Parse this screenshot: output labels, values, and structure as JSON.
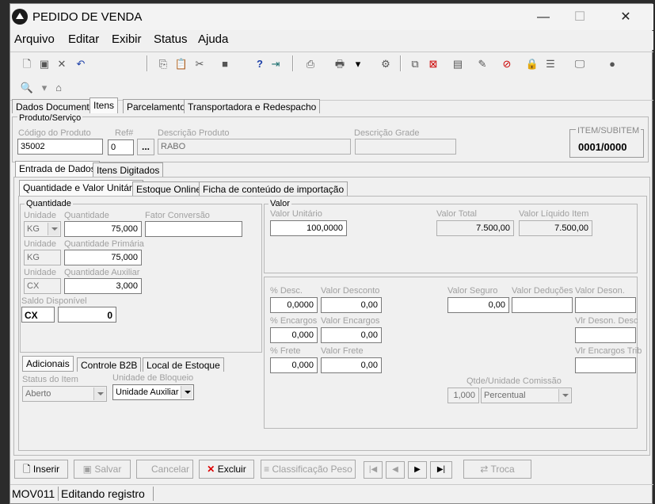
{
  "window": {
    "title": "PEDIDO DE VENDA"
  },
  "titlebar_buttons": {
    "minimize": "—",
    "maximize": "☐",
    "close": "✕"
  },
  "menu": [
    "Arquivo",
    "Editar",
    "Exibir",
    "Status",
    "Ajuda"
  ],
  "main_tabs": [
    "Dados Documento",
    "Itens",
    "Parcelamento",
    "Transportadora e Redespacho"
  ],
  "produto": {
    "group_label": "Produto/Serviço",
    "codigo_label": "Código do Produto",
    "codigo_value": "35002",
    "ref_label": "Ref#",
    "ref_value": "0",
    "lookup_button": "...",
    "descricao_label": "Descrição Produto",
    "descricao_value": "RABO",
    "grade_label": "Descrição Grade",
    "grade_value": "",
    "item_label": "ITEM/SUBITEM",
    "item_value": "0001/0000"
  },
  "sub_tabs": [
    "Entrada de Dados",
    "Itens Digitados"
  ],
  "inner_tabs": [
    "Quantidade e Valor Unitário",
    "Estoque Online",
    "Ficha de conteúdo de importação"
  ],
  "quantidade": {
    "group_label": "Quantidade",
    "unidade_label": "Unidade",
    "unidade_value": "KG",
    "quantidade_label": "Quantidade",
    "quantidade_value": "75,000",
    "fator_label": "Fator Conversão",
    "fator_value": "",
    "unidade2_label": "Unidade",
    "unidade2_value": "KG",
    "primaria_label": "Quantidade Primária",
    "primaria_value": "75,000",
    "unidade3_label": "Unidade",
    "unidade3_value": "CX",
    "auxiliar_label": "Quantidade Auxiliar",
    "auxiliar_value": "3,000",
    "saldo_label": "Saldo Disponível",
    "saldo_unit": "CX",
    "saldo_value": "0"
  },
  "valor": {
    "group_label": "Valor",
    "unitario_label": "Valor Unitário",
    "unitario_value": "100,0000",
    "total_label": "Valor Total",
    "total_value": "7.500,00",
    "liquido_label": "Valor Líquido Item",
    "liquido_value": "7.500,00"
  },
  "encargos": {
    "desc_pct_label": "% Desc.",
    "desc_pct_value": "0,0000",
    "desc_val_label": "Valor Desconto",
    "desc_val_value": "0,00",
    "seguro_label": "Valor Seguro",
    "seguro_value": "0,00",
    "deducoes_label": "Valor Deduções",
    "deducoes_value": "",
    "deson_label": "Valor Deson.",
    "deson_value": "",
    "enc_pct_label": "% Encargos",
    "enc_pct_value": "0,000",
    "enc_val_label": "Valor Encargos",
    "enc_val_value": "0,00",
    "vlr_deson_desc_label": "Vlr Deson. Desc",
    "vlr_deson_desc_value": "",
    "frete_pct_label": "% Frete",
    "frete_pct_value": "0,000",
    "frete_val_label": "Valor Frete",
    "frete_val_value": "0,00",
    "vlr_enc_trib_label": "Vlr Encargos Trib",
    "vlr_enc_trib_value": "",
    "comissao_label": "Qtde/Unidade Comissão",
    "comissao_value": "1,000",
    "comissao_tipo": "Percentual"
  },
  "bottom_tabs": [
    "Adicionais",
    "Controle B2B",
    "Local de Estoque"
  ],
  "adicionais": {
    "status_label": "Status do Item",
    "status_value": "Aberto",
    "bloqueio_label": "Unidade de Bloqueio",
    "bloqueio_value": "Unidade Auxiliar"
  },
  "buttons": {
    "inserir": "Inserir",
    "salvar": "Salvar",
    "cancelar": "Cancelar",
    "excluir": "Excluir",
    "classificacao": "Classificação Peso",
    "troca": "Troca"
  },
  "nav_buttons": [
    "|◀",
    "◀",
    "▶",
    "▶|"
  ],
  "statusbar": {
    "code": "MOV011",
    "text": "Editando registro"
  }
}
